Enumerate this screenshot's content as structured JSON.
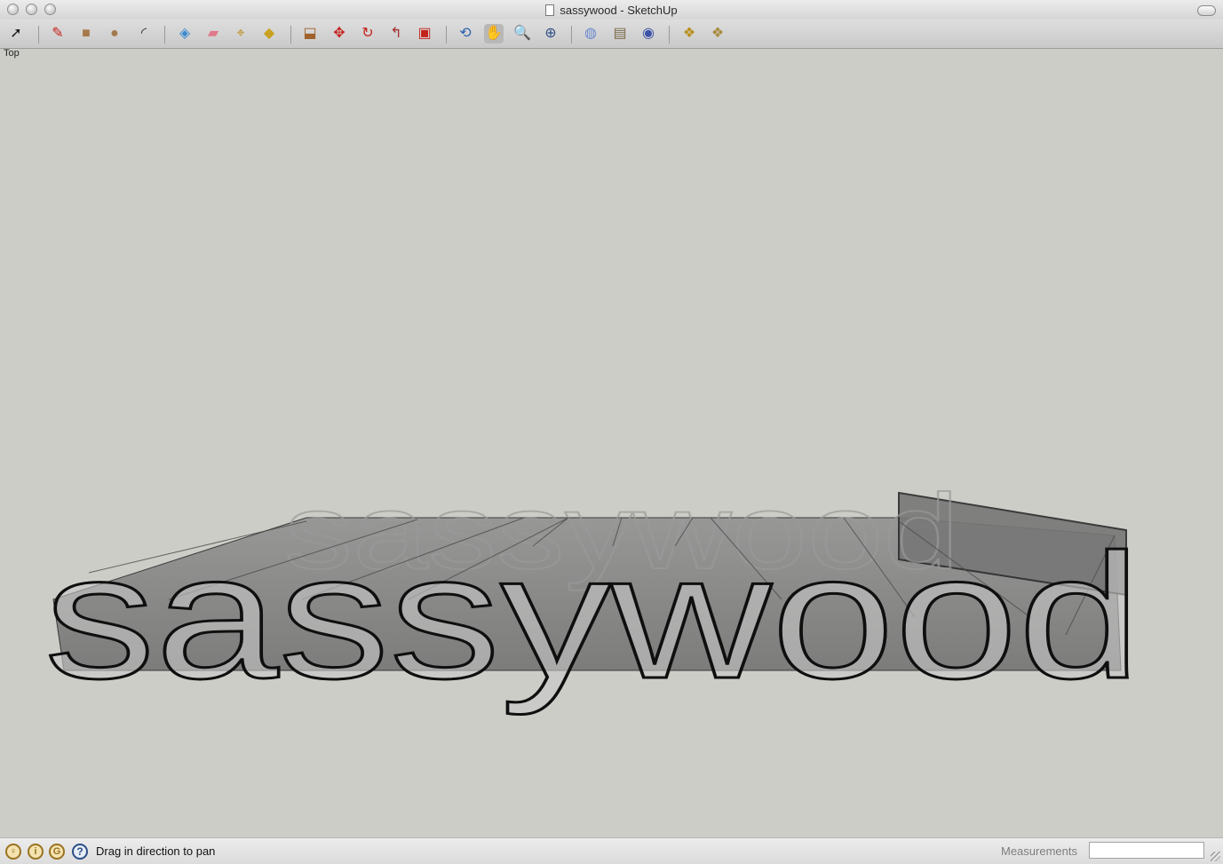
{
  "window": {
    "title": "sassywood - SketchUp"
  },
  "toolbar": {
    "tools": [
      {
        "name": "select-tool",
        "glyph": "➚",
        "color": "#1a1a1a"
      },
      {
        "name": "line-tool",
        "glyph": "✎",
        "color": "#c4221c"
      },
      {
        "name": "rectangle-tool",
        "glyph": "■",
        "color": "#a7794a"
      },
      {
        "name": "circle-tool",
        "glyph": "●",
        "color": "#a37a4f"
      },
      {
        "name": "arc-tool",
        "glyph": "◜",
        "color": "#333333"
      },
      {
        "name": "make-component-tool",
        "glyph": "◈",
        "color": "#3c8ad0"
      },
      {
        "name": "eraser-tool",
        "glyph": "▰",
        "color": "#e07a8a"
      },
      {
        "name": "tape-measure-tool",
        "glyph": "⌖",
        "color": "#b88c1a"
      },
      {
        "name": "paint-bucket-tool",
        "glyph": "◆",
        "color": "#c8a220"
      },
      {
        "name": "push-pull-tool",
        "glyph": "⬓",
        "color": "#a0622a"
      },
      {
        "name": "move-tool",
        "glyph": "✥",
        "color": "#c4221c"
      },
      {
        "name": "rotate-tool",
        "glyph": "↻",
        "color": "#c4221c"
      },
      {
        "name": "follow-me-tool",
        "glyph": "↰",
        "color": "#a33030"
      },
      {
        "name": "offset-tool",
        "glyph": "▣",
        "color": "#c4221c"
      },
      {
        "name": "orbit-tool",
        "glyph": "⟲",
        "color": "#2f62b0"
      },
      {
        "name": "pan-tool",
        "glyph": "✋",
        "color": "#444444",
        "active": true
      },
      {
        "name": "zoom-tool",
        "glyph": "🔍",
        "color": "#2f4f86"
      },
      {
        "name": "zoom-extents-tool",
        "glyph": "⊕",
        "color": "#2f4f86"
      },
      {
        "name": "get-models-tool",
        "glyph": "◍",
        "color": "#6a8ad0"
      },
      {
        "name": "share-model-tool",
        "glyph": "▤",
        "color": "#7a6a4a"
      },
      {
        "name": "google-earth-tool",
        "glyph": "◉",
        "color": "#3b52a8"
      },
      {
        "name": "get-components-tool",
        "glyph": "❖",
        "color": "#b8901c"
      },
      {
        "name": "share-component-tool",
        "glyph": "❖",
        "color": "#a88b3c"
      }
    ]
  },
  "viewport": {
    "scene_label": "Top",
    "model_text": "sassywood"
  },
  "statusbar": {
    "icons": [
      {
        "name": "geo-location-icon",
        "glyph": "♀"
      },
      {
        "name": "credits-icon",
        "glyph": "i"
      },
      {
        "name": "google-icon",
        "glyph": "G"
      },
      {
        "name": "help-icon",
        "glyph": "?"
      }
    ],
    "status_text": "Drag in direction to pan",
    "measurements_label": "Measurements",
    "measurements_value": ""
  }
}
